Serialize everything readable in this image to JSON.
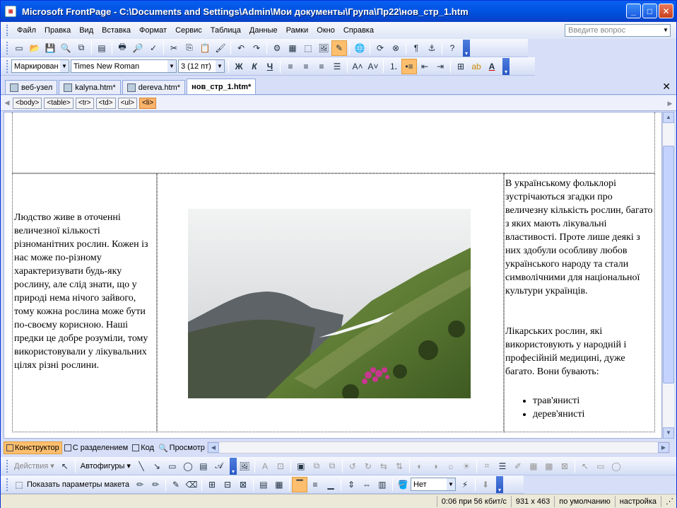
{
  "window": {
    "title": "Microsoft FrontPage - C:\\Documents and Settings\\Admin\\Мои документы\\Група\\Пр22\\нов_стр_1.htm"
  },
  "menu": {
    "items": [
      "Файл",
      "Правка",
      "Вид",
      "Вставка",
      "Формат",
      "Сервис",
      "Таблица",
      "Данные",
      "Рамки",
      "Окно",
      "Справка"
    ],
    "ask_placeholder": "Введите вопрос"
  },
  "format": {
    "style": "Маркирован",
    "font": "Times New Roman",
    "size": "3  (12 пт)",
    "bold": "Ж",
    "italic": "К",
    "underline": "Ч"
  },
  "tabs": [
    {
      "label": "веб-узел"
    },
    {
      "label": "kalyna.htm*"
    },
    {
      "label": "dereva.htm*"
    },
    {
      "label": "нов_стр_1.htm*"
    }
  ],
  "quicktags": [
    "<body>",
    "<table>",
    "<tr>",
    "<td>",
    "<ul>",
    "<li>"
  ],
  "content": {
    "left_text": "Людство живе в оточенні величезної кількості різноманітних рослин. Кожен із нас може по-різному характеризувати будь-яку рослину, але слід знати, що у природі нема нічого зайвого, тому кожна рослина може бути по-своєму корисною. Наші предки це добре розуміли, тому використовували у лікувальних цілях різні рослини.",
    "right_p1": "В українському фольклорі зустрічаються згадки про величезну кількість рослин, багато з яких мають лікувальні властивості. Проте лише деякі з них здобули особливу любов українського народу та стали символічними для національної культури українців.",
    "right_p2": "Лікарських рослин, які використовують у народній і професійній медицині, дуже багато. Вони бувають:",
    "list": [
      "трав'янисті",
      "дерев'янисті"
    ]
  },
  "views": [
    {
      "label": "Конструктор"
    },
    {
      "label": "С разделением"
    },
    {
      "label": "Код"
    },
    {
      "label": "Просмотр"
    }
  ],
  "drawing": {
    "actions": "Действия",
    "autoshapes": "Автофигуры"
  },
  "tables_bar": {
    "show_layout": "Показать параметры макета",
    "fill_value": "Нет"
  },
  "status": {
    "speed": "0:06 при 56 кбит/с",
    "size": "931 x 463",
    "mode": "по умолчанию",
    "custom": "настройка"
  }
}
